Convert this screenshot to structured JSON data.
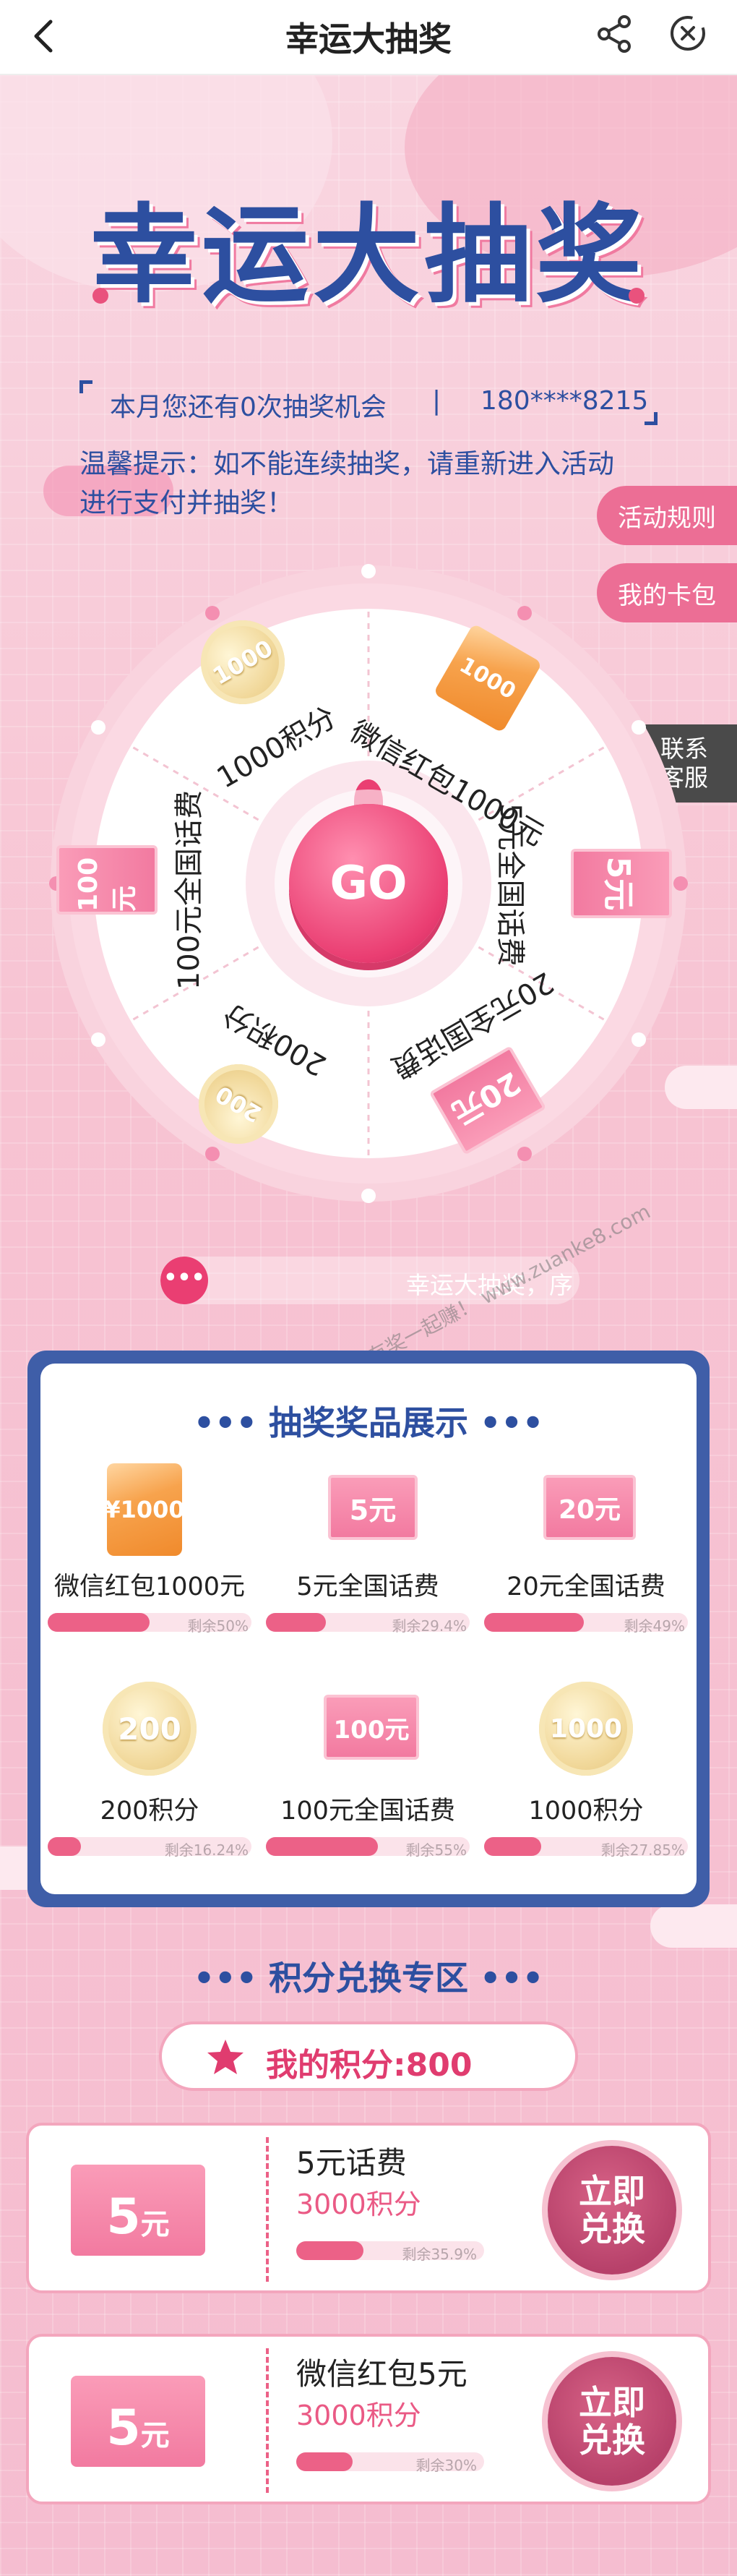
{
  "nav": {
    "title": "幸运大抽奖"
  },
  "hero": {
    "title": "幸运大抽奖",
    "chances": "本月您还有0次抽奖机会",
    "separator": "|",
    "phone": "180****8215",
    "tip": "温馨提示：如不能连续抽奖，请重新进入活动进行支付并抽奖！"
  },
  "side": {
    "rules": "活动规则",
    "wallet": "我的卡包",
    "contact_line1": "联系",
    "contact_line2": "客服"
  },
  "wheel": {
    "go": "GO",
    "segments": [
      {
        "label": "微信红包1000元",
        "badge": "1000"
      },
      {
        "label": "5元全国话费",
        "badge": "5元"
      },
      {
        "label": "20元全国话费",
        "badge": "20元"
      },
      {
        "label": "200积分",
        "badge": "200"
      },
      {
        "label": "100元全国话费",
        "badge": "100元"
      },
      {
        "label": "1000积分",
        "badge": "1000"
      }
    ]
  },
  "marquee": {
    "dots": "•••",
    "text": "幸运大抽奖，序"
  },
  "watermark": "赚客吧，有奖一起赚！ www.zuanke8.com",
  "showcase": {
    "title": "抽奖奖品展示",
    "prizes": [
      {
        "name": "微信红包1000元",
        "badge": "¥1000",
        "remain": "剩余50%",
        "remain_fraction": 0.5
      },
      {
        "name": "5元全国话费",
        "badge": "5元",
        "remain": "剩余29.4%",
        "remain_fraction": 0.294
      },
      {
        "name": "20元全国话费",
        "badge": "20元",
        "remain": "剩余49%",
        "remain_fraction": 0.49
      },
      {
        "name": "200积分",
        "badge": "200",
        "remain": "剩余16.24%",
        "remain_fraction": 0.1624
      },
      {
        "name": "100元全国话费",
        "badge": "100元",
        "remain": "剩余55%",
        "remain_fraction": 0.55
      },
      {
        "name": "1000积分",
        "badge": "1000",
        "remain": "剩余27.85%",
        "remain_fraction": 0.2785
      }
    ]
  },
  "exchange": {
    "title": "积分兑换专区",
    "my_points": "我的积分:800",
    "items": [
      {
        "badge_num": "5",
        "badge_unit": "元",
        "name": "5元话费",
        "cost": "3000积分",
        "remain": "剩余35.9%",
        "remain_fraction": 0.359,
        "button": "立即兑换"
      },
      {
        "badge_num": "5",
        "badge_unit": "元",
        "name": "微信红包5元",
        "cost": "3000积分",
        "remain": "剩余30%",
        "remain_fraction": 0.3,
        "button": "立即兑换"
      }
    ]
  },
  "colors": {
    "accent": "#ea3e72",
    "brand_blue": "#2d4fa0",
    "background": "#f8c3d3"
  }
}
